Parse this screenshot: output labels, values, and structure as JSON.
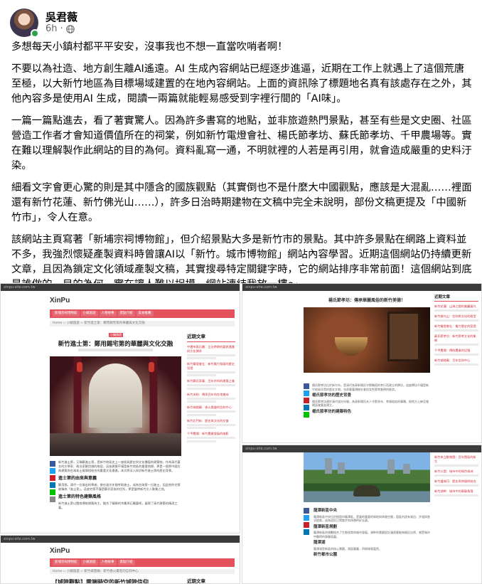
{
  "post": {
    "author": "吳君薇",
    "time": "6h",
    "separator": "·",
    "paragraphs": [
      "多想每天小鎮村都平平安安，沒事我也不想一直當吹哨者啊！",
      "不要以為社造、地方創生離AI遙遠。AI 生成內容網站已經逐步進逼，近期在工作上就遇上了這個荒唐至極，以大新竹地區為目標場域建置的在地內容網站。上面的資訊除了標題地名真有該處存在之外，其他內容多是使用AI 生成，閱讀一兩篇就能輕易感受到字裡行間的「AI味」。",
      "一篇一篇點進去，看了著實驚人。因為許多書寫的地點，並非旅遊熱門景點，甚至有些是文史圈、社區營造工作者才會知道價值所在的祠棠，例如新竹電燈會社、楊氏節孝坊、蘇氏節孝坊、千甲農場等。實在難以理解製作此網站的目的為何。資料亂寫一通，不明就裡的人若是再引用，就會造成嚴重的史料汙染。",
      "細看文字會更心驚的則是其中隱含的國族觀點（其實倒也不是什麼大中國觀點，應該是大混亂……裡面還有新竹花蓮、新竹佛光山……），許多日治時期建物在文稿中完全未說明，部份文稿更提及「中國新竹市」，令人在意。",
      "該網站主頁寫著「新埔宗祠博物館」，但介紹景點大多是新竹市的景點。其中許多景點在網路上資料並不多，我強烈懷疑產製資料時曾讓AI以「新竹。城市博物館」網站內容學習。近期這個網站仍持續更新文章，且因為鎖定文化領域產製文稿，其實搜尋特定關鍵字時，它的網站排序非常前面！這個網站到底是誰做的、目的為何，實在讓人難以捉摸。網站連結我放一樓〜"
    ]
  },
  "screenshots": {
    "a": {
      "bar": "xinpu-site.com.tw",
      "logo": "XinPu",
      "nav": [
        "新埔宗祠博物館",
        "小鎮旅遊",
        "人物故事",
        "景點介紹",
        "美食推薦"
      ],
      "crumb": "Home ›› 小鎮旅遊 ›› 新竹進士第：鄭用錫宅第的華麗與文化交融",
      "tag": "小鎮旅遊",
      "title": "新竹進士第：鄭用錫宅第的華麗與文化交融",
      "body_text": "新竹進士第，又稱鄭進士第，是新竹地區史上一座極具歷史與文化價值的建築物，作為清代著名的文學家、政治家鄭用錫的故居，這座建築不僅是新竹地區的重要地標，更是一個將中國古典建築與台灣本土風情相結合的重要文化遺產。本文將深入探討新竹進士第的歷史背景。",
      "h1": "進士第的由來與意義",
      "text2": "鄭用錫，清代一位傑出的學者，曾在道光年間考取進士，成為台灣第一位進士，因此他的宅第被稱為「進士第」。這座宅第不僅是鄭氏家族的住所，更是當時新竹文人聚集之地。",
      "h2": "進士第的特色建築風格",
      "text3": "新竹進士第以閩南傳統建築為主，融合了精緻的木雕與石雕藝術，展現了清代建築的精湛工藝。",
      "sidebar_title": "近期文章",
      "sidebar": [
        "中壢市區石雕：日治時期的藝術遺產與文化傳承",
        "新竹電燈會社：新竹電力發展的歷史見證",
        "新竹鄭氏家廟：百年宗祠的建築之美",
        "新竹米粉：傳承百年的在地美味",
        "新竹城隍廟：香火鼎盛的信仰中心",
        "新竹北門街：歷史與文化的交會",
        "千甲農場：新竹農業發展的縮影"
      ]
    },
    "b": {
      "bar": "xinpu-site.com.tw",
      "heading": "楊氏節孝坊：傳承華麗風俗的新竹美德！",
      "body_text": "楊氏節孝坊位於新竹市，是清代為表彰楊氏守節撫孤的孝行而建立的牌坊，這座牌坊不僅是新竹地區珍貴的歷史文物，也承載著傳統社會對女性節孝美德的推崇。",
      "h1": "楊氏節孝坊的歷史背景",
      "text2": "楊氏節孝坊建於清代道光年間，為表彰楊氏夫人守節多年、孝順翁姑的事蹟，經地方士紳呈報朝廷後獲准建立。",
      "h2": "楊氏節孝坊的建築特色",
      "sidebar_title": "近期文章",
      "sidebar": [
        "新竹花蓮：山海之間的美麗風光",
        "新竹佛光山：信仰與文化的殿堂",
        "新竹電燈會社：電力歷史的見證",
        "蘇氏節孝坊：新竹節孝文化的象徵",
        "千甲農場：傳統農業的記憶",
        "新竹城隍廟：百年信仰中心"
      ]
    },
    "c": {
      "bar": "xinpu-site.com.tw",
      "h1": "龍潭新區中央",
      "text1": "龍潭新區中央位於桃園市龍潭區，是當地重要的綠地與休閒空間，園區內設有湖泊、步道與各式植栽，成為居民日常散步與休憩的好去處。",
      "h2": "龍潭新區規劃",
      "text2": "龍潭新區的規劃結合了生態保育與城市發展，湖畔的景觀設計讓遊客能夠親近自然，感受城市中難得的寧靜氛圍。",
      "h3": "龍潭湖",
      "text3": "龍潭湖是新區的核心景觀，湖面寬廣，四周綠意盎然。",
      "h4": "新竹都市公園",
      "sidebar": [
        "新竹市立動物園：百年園區的新生",
        "新竹公園：城市中的綠色綠洲",
        "新竹護城河：歷史與休閒的結合",
        "新竹湖畔：城市中的寧靜角落"
      ]
    },
    "d": {
      "bar": "xinpu-site.com.tw",
      "logo": "XinPu",
      "nav": [
        "新埔宗祠博物館",
        "小鎮旅遊",
        "人物故事",
        "景點介紹"
      ],
      "crumb": "Home ›› 小鎮旅遊 ›› 新竹城隍廟：新竹香火最旺的信仰中心",
      "title": "【城隍觀點】雲端時空的新竹城隍信仰",
      "sidebar_title": "近期文章"
    }
  },
  "colors": {
    "accent": "#e2515c",
    "online": "#31a24c",
    "meta": "#65676b"
  }
}
